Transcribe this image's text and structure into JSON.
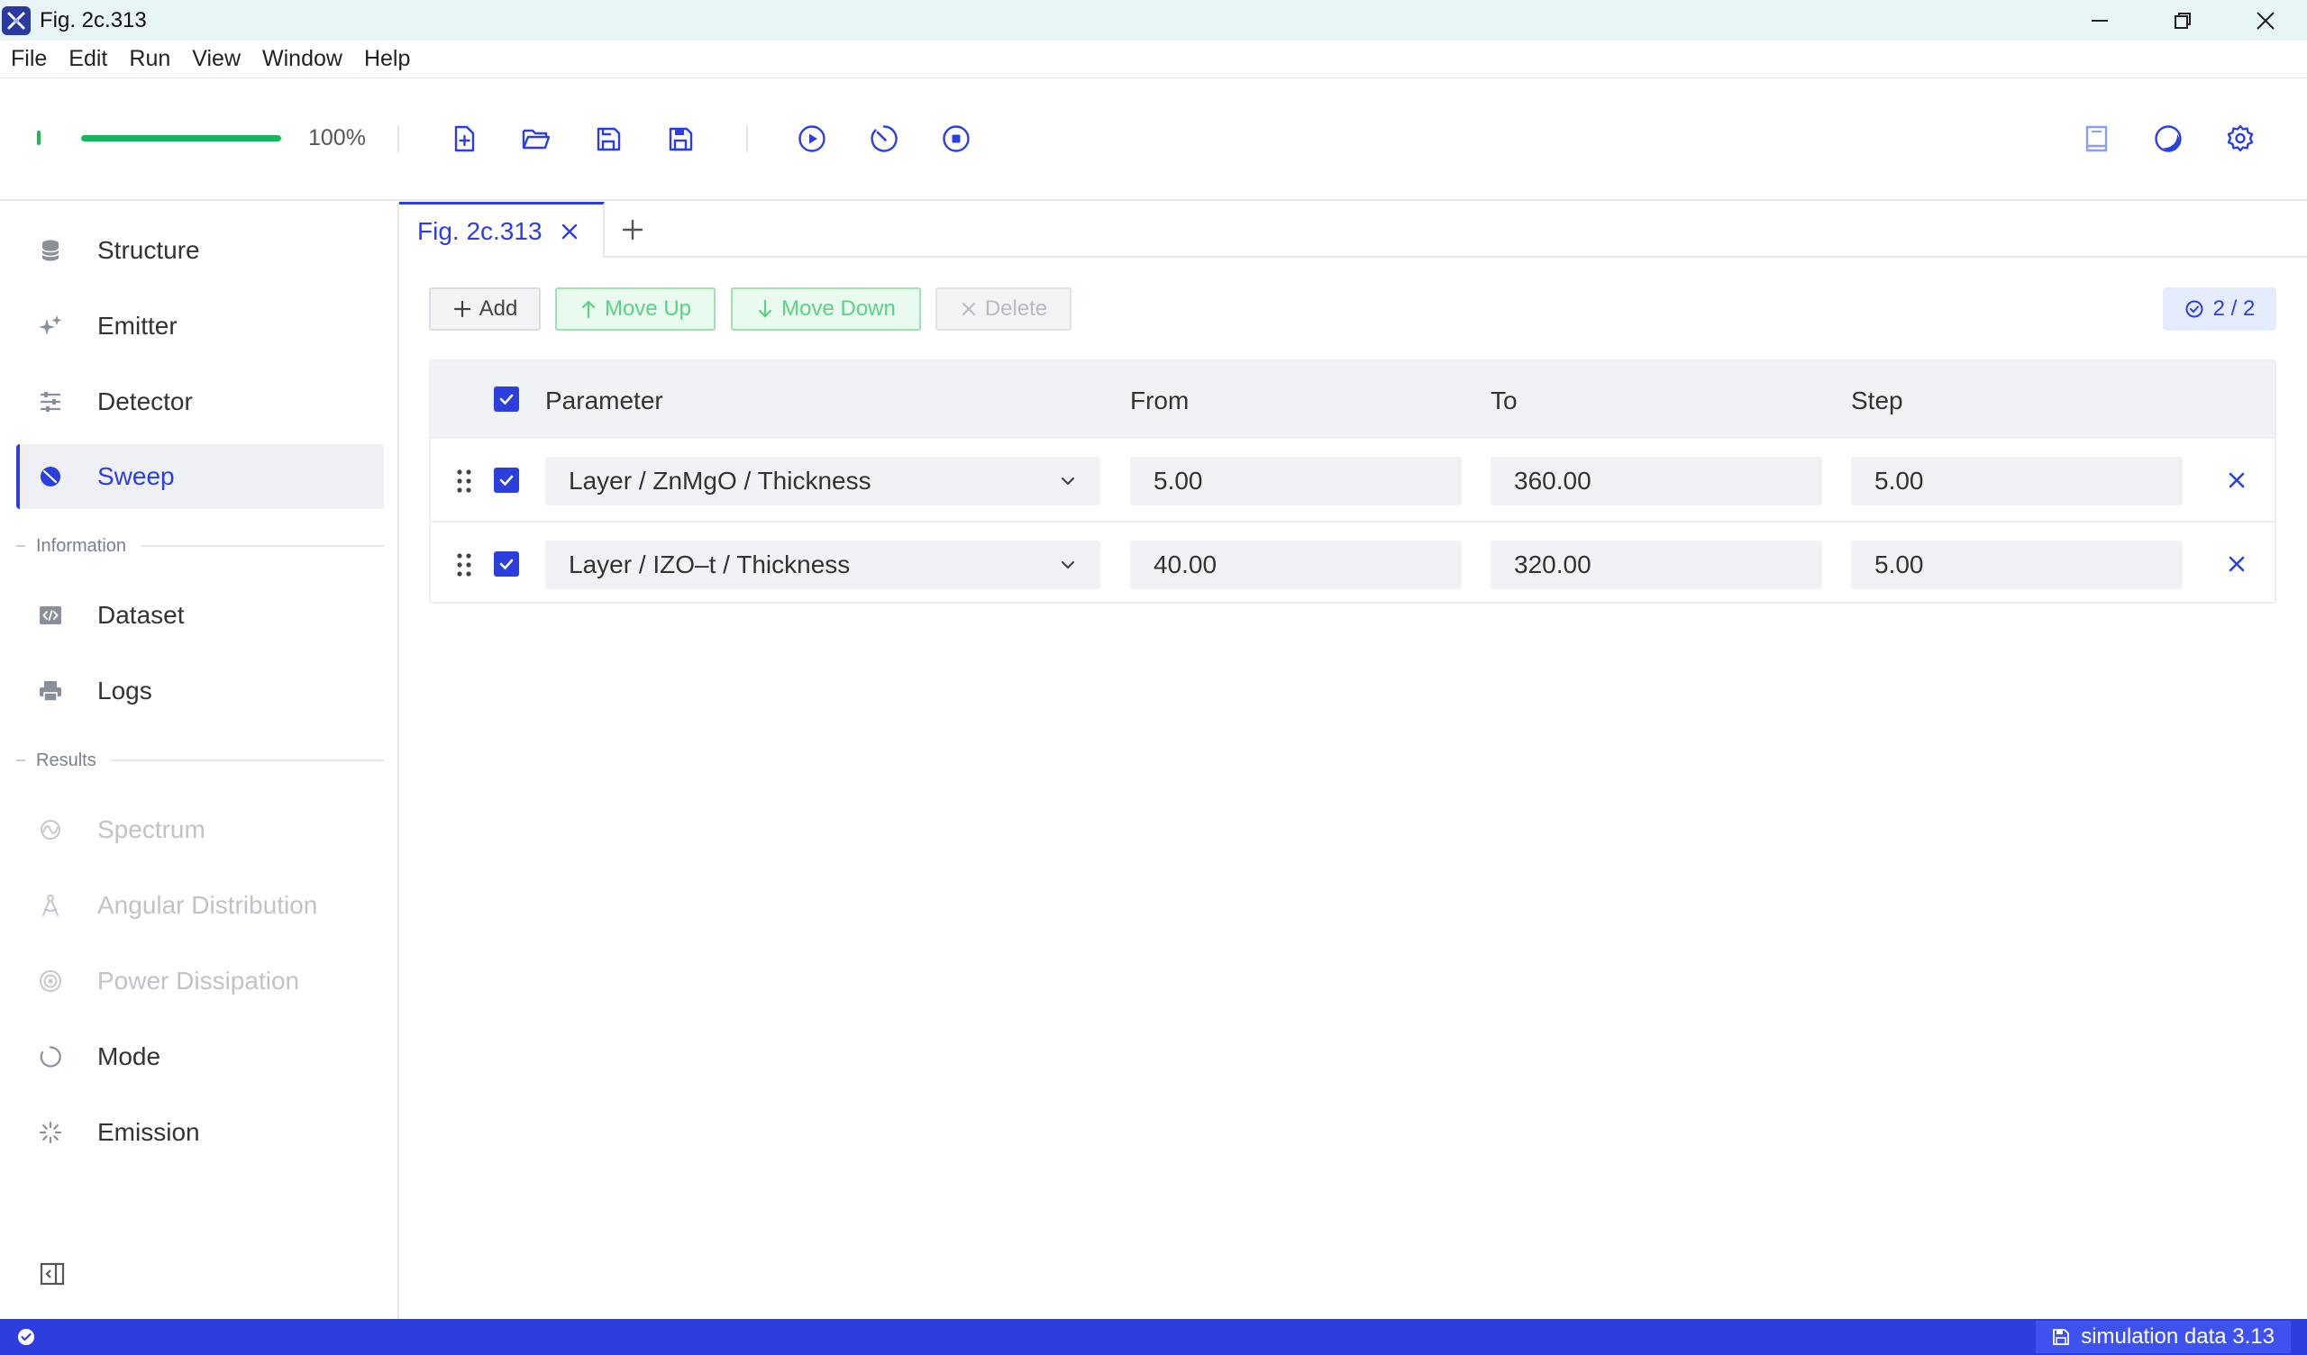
{
  "window": {
    "title": "Fig. 2c.313"
  },
  "menu": [
    "File",
    "Edit",
    "Run",
    "View",
    "Window",
    "Help"
  ],
  "toolbar": {
    "progress_percent": 100,
    "progress_label": "100%",
    "file_icons": [
      "new-file-icon",
      "open-folder-icon",
      "save-icon",
      "save-as-icon"
    ],
    "run_icons": [
      "play-icon",
      "timer-icon",
      "stop-icon"
    ],
    "right_icons": [
      "book-icon",
      "theme-icon",
      "settings-icon"
    ],
    "accent_color": "#2c3fde",
    "progress_color": "#16b65a"
  },
  "sidebar": {
    "items": [
      {
        "label": "Structure",
        "icon": "database-icon",
        "state": "normal"
      },
      {
        "label": "Emitter",
        "icon": "sparkle-icon",
        "state": "normal"
      },
      {
        "label": "Detector",
        "icon": "sliders-icon",
        "state": "normal"
      },
      {
        "label": "Sweep",
        "icon": "sweep-icon",
        "state": "active"
      }
    ],
    "section_information": "Information",
    "info_items": [
      {
        "label": "Dataset",
        "icon": "code-icon"
      },
      {
        "label": "Logs",
        "icon": "printer-icon"
      }
    ],
    "section_results": "Results",
    "result_items": [
      {
        "label": "Spectrum",
        "icon": "spectrum-icon",
        "state": "disabled"
      },
      {
        "label": "Angular Distribution",
        "icon": "compass-icon",
        "state": "disabled"
      },
      {
        "label": "Power Dissipation",
        "icon": "power-icon",
        "state": "disabled"
      },
      {
        "label": "Mode",
        "icon": "mode-icon",
        "state": "normal"
      },
      {
        "label": "Emission",
        "icon": "loading-icon",
        "state": "normal"
      }
    ]
  },
  "tabs": [
    {
      "label": "Fig. 2c.313",
      "active": true
    }
  ],
  "actions": {
    "add": "Add",
    "move_up": "Move Up",
    "move_down": "Move Down",
    "delete": "Delete",
    "counter": "2 / 2"
  },
  "table": {
    "headers": {
      "parameter": "Parameter",
      "from": "From",
      "to": "To",
      "step": "Step"
    },
    "rows": [
      {
        "parameter": "Layer / ZnMgO / Thickness",
        "from": "5.00",
        "to": "360.00",
        "step": "5.00",
        "checked": true
      },
      {
        "parameter": "Layer / IZO–t / Thickness",
        "from": "40.00",
        "to": "320.00",
        "step": "5.00",
        "checked": true
      }
    ]
  },
  "status": {
    "right_label": "simulation data 3.13"
  }
}
